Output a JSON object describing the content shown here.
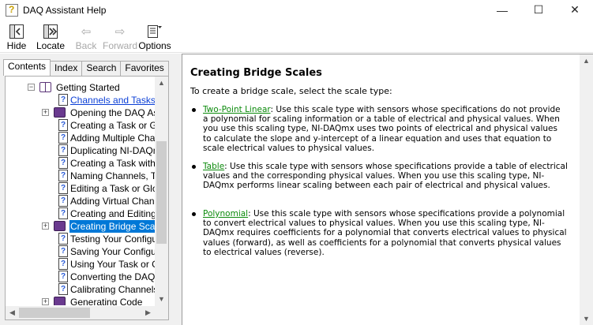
{
  "window": {
    "title": "DAQ Assistant Help"
  },
  "toolbar": {
    "hide": "Hide",
    "locate": "Locate",
    "back": "Back",
    "forward": "Forward",
    "options": "Options"
  },
  "tabs": [
    "Contents",
    "Index",
    "Search",
    "Favorites"
  ],
  "tree": [
    {
      "label": "Getting Started",
      "icon": "book-open-icon",
      "expander": "minus",
      "level": 0,
      "style": "normal"
    },
    {
      "label": "Channels and Tasks",
      "icon": "help-page-icon",
      "expander": "",
      "level": 1,
      "style": "link"
    },
    {
      "label": "Opening the DAQ Assi",
      "icon": "book-icon",
      "expander": "plus",
      "level": 1,
      "style": "normal"
    },
    {
      "label": "Creating a Task or Glo",
      "icon": "help-page-icon",
      "expander": "",
      "level": 1,
      "style": "normal"
    },
    {
      "label": "Adding Multiple Chann",
      "icon": "help-page-icon",
      "expander": "",
      "level": 1,
      "style": "normal"
    },
    {
      "label": "Duplicating NI-DAQmx",
      "icon": "help-page-icon",
      "expander": "",
      "level": 1,
      "style": "normal"
    },
    {
      "label": "Creating a Task with M",
      "icon": "help-page-icon",
      "expander": "",
      "level": 1,
      "style": "normal"
    },
    {
      "label": "Naming Channels, Tas",
      "icon": "help-page-icon",
      "expander": "",
      "level": 1,
      "style": "normal"
    },
    {
      "label": "Editing a Task or Glob",
      "icon": "help-page-icon",
      "expander": "",
      "level": 1,
      "style": "normal"
    },
    {
      "label": "Adding Virtual Channe",
      "icon": "help-page-icon",
      "expander": "",
      "level": 1,
      "style": "normal"
    },
    {
      "label": "Creating and Editing S",
      "icon": "help-page-icon",
      "expander": "",
      "level": 1,
      "style": "normal"
    },
    {
      "label": "Creating Bridge Scales",
      "icon": "book-icon",
      "expander": "plus",
      "level": 1,
      "style": "selected"
    },
    {
      "label": "Testing Your Configura",
      "icon": "help-page-icon",
      "expander": "",
      "level": 1,
      "style": "normal"
    },
    {
      "label": "Saving Your Configura",
      "icon": "help-page-icon",
      "expander": "",
      "level": 1,
      "style": "normal"
    },
    {
      "label": "Using Your Task or Gl",
      "icon": "help-page-icon",
      "expander": "",
      "level": 1,
      "style": "normal"
    },
    {
      "label": "Converting the DAQ A",
      "icon": "help-page-icon",
      "expander": "",
      "level": 1,
      "style": "normal"
    },
    {
      "label": "Calibrating Channels",
      "icon": "help-page-icon",
      "expander": "",
      "level": 1,
      "style": "normal"
    },
    {
      "label": "Generating Code",
      "icon": "book-icon",
      "expander": "plus",
      "level": 1,
      "style": "normal"
    }
  ],
  "content": {
    "heading": "Creating Bridge Scales",
    "intro": "To create a bridge scale, select the scale type:",
    "bullets": [
      {
        "term": "Two-Point Linear",
        "text": ": Use this scale type with sensors whose specifications do not provide a polynomial for scaling information or a table of electrical and physical values. When you use this scaling type, NI-DAQmx uses two points of electrical and physical values to calculate the slope and y-intercept of a linear equation and uses that equation to scale electrical values to physical values."
      },
      {
        "term": "Table",
        "text": ": Use this scale type with sensors whose specifications provide a table of electrical values and the corresponding physical values. When you use this scaling type, NI-DAQmx performs linear scaling between each pair of electrical and physical values."
      },
      {
        "term": "Polynomial",
        "text": ": Use this scale type with sensors whose specifications provide a polynomial to convert electrical values to physical values. When you use this scaling type, NI-DAQmx requires coefficients for a polynomial that converts electrical values to physical values (forward), as well as coefficients for a polynomial that converts physical values to electrical values (reverse)."
      }
    ]
  }
}
